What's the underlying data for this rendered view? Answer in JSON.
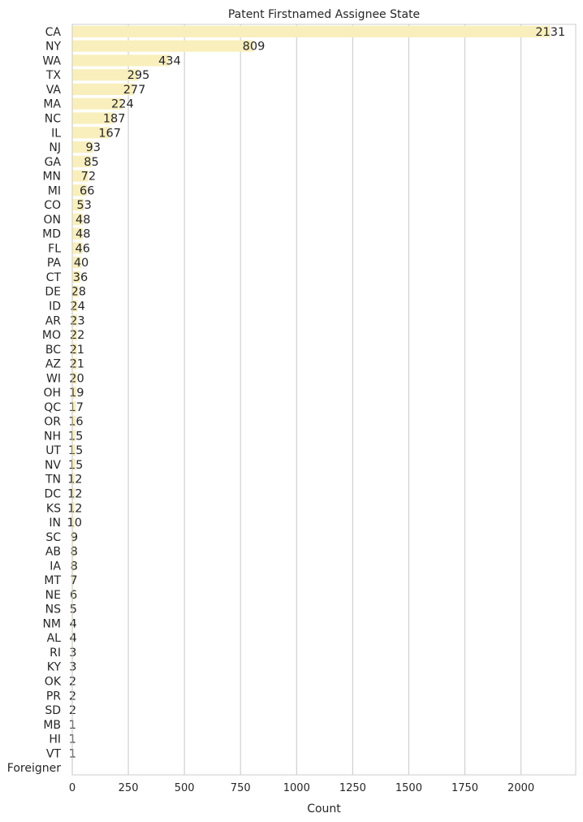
{
  "chart_data": {
    "type": "bar",
    "orientation": "horizontal",
    "title": "Patent Firstnamed Assignee State",
    "xlabel": "Count",
    "ylabel": "",
    "xlim": [
      0,
      2250
    ],
    "xticks": [
      0,
      250,
      500,
      750,
      1000,
      1250,
      1500,
      1750,
      2000
    ],
    "grid": "vertical",
    "bar_color": "#f9efbd",
    "grid_color": "#d0d0d0",
    "categories": [
      "CA",
      "NY",
      "WA",
      "TX",
      "VA",
      "MA",
      "NC",
      "IL",
      "NJ",
      "GA",
      "MN",
      "MI",
      "CO",
      "ON",
      "MD",
      "FL",
      "PA",
      "CT",
      "DE",
      "ID",
      "AR",
      "MO",
      "BC",
      "AZ",
      "WI",
      "OH",
      "QC",
      "OR",
      "NH",
      "UT",
      "NV",
      "TN",
      "DC",
      "KS",
      "IN",
      "SC",
      "AB",
      "IA",
      "MT",
      "NE",
      "NS",
      "NM",
      "AL",
      "RI",
      "KY",
      "OK",
      "PR",
      "SD",
      "MB",
      "HI",
      "VT",
      "Foreigner"
    ],
    "values": [
      2131,
      809,
      434,
      295,
      277,
      224,
      187,
      167,
      93,
      85,
      72,
      66,
      53,
      48,
      48,
      46,
      40,
      36,
      28,
      24,
      23,
      22,
      21,
      21,
      20,
      19,
      17,
      16,
      15,
      15,
      15,
      12,
      12,
      12,
      10,
      9,
      8,
      8,
      7,
      6,
      5,
      4,
      4,
      3,
      3,
      2,
      2,
      2,
      1,
      1,
      1,
      null
    ],
    "data_labels": [
      "2131",
      "809",
      "434",
      "295",
      "277",
      "224",
      "187",
      "167",
      "93",
      "85",
      "72",
      "66",
      "53",
      "48",
      "48",
      "46",
      "40",
      "36",
      "28",
      "24",
      "23",
      "22",
      "21",
      "21",
      "20",
      "19",
      "17",
      "16",
      "15",
      "15",
      "15",
      "12",
      "12",
      "12",
      "10",
      "9",
      "8",
      "8",
      "7",
      "6",
      "5",
      "4",
      "4",
      "3",
      "3",
      "2",
      "2",
      "2",
      "1",
      "1",
      "1",
      ""
    ]
  }
}
